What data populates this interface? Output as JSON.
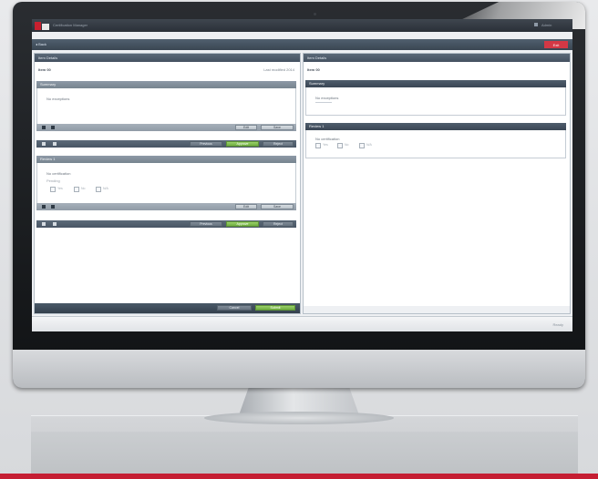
{
  "app": {
    "title": "Certification Manager",
    "status_right": "Admin"
  },
  "toolbar": {
    "back_label": "◂ Back",
    "exit_label": "Exit"
  },
  "left_panel": {
    "header": "Item Details",
    "item_label": "Item 00",
    "item_meta": "Last modified 2014",
    "section1": {
      "header": "Summary",
      "line1": "No exceptions",
      "bar_buttons": [
        "Edit",
        "Save"
      ],
      "nav_buttons": [
        "Previous",
        "Approve",
        "Reject"
      ]
    },
    "section2": {
      "header": "Review 1",
      "line1": "No certification",
      "line2": "Pending",
      "checkbox_options": [
        "Yes",
        "No",
        "N/A"
      ],
      "bar_buttons": [
        "Edit",
        "Save"
      ],
      "nav_buttons": [
        "Previous",
        "Approve",
        "Reject"
      ]
    },
    "footer_buttons": [
      "Cancel",
      "Submit"
    ]
  },
  "right_panel": {
    "header": "Item Details",
    "item_label": "Item 00",
    "section1": {
      "header": "Summary",
      "line1": "No exceptions"
    },
    "section2": {
      "header": "Review 1",
      "line1": "No certification",
      "checkbox_options": [
        "Yes",
        "No",
        "N/A"
      ]
    }
  },
  "statusbar": {
    "text": "Ready"
  },
  "colors": {
    "accent_red": "#c7202f",
    "header_dark": "#445160",
    "approve_green": "#6fae40"
  }
}
